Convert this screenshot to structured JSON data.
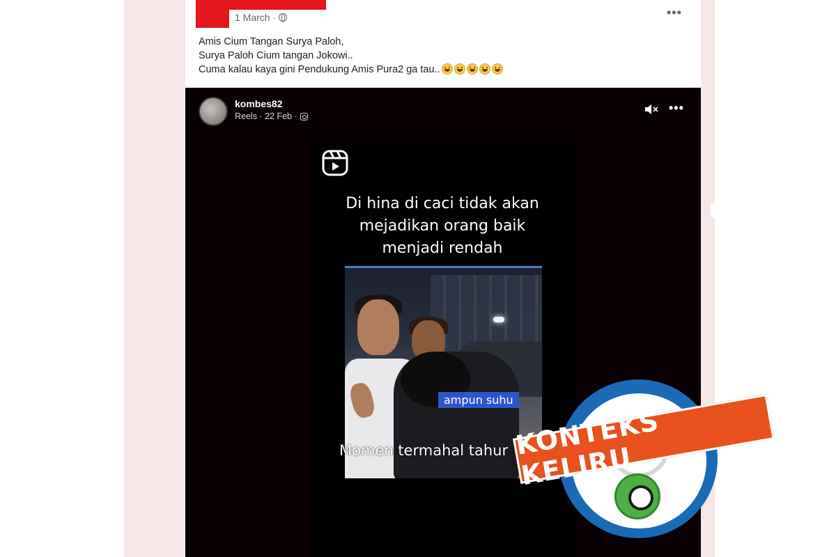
{
  "post": {
    "date": "1 March",
    "text_lines": [
      "Amis Cium Tangan Surya Paloh,",
      "Surya Paloh Cium tangan Jokowi..",
      "Cuma kalau kaya gini Pendukung Amis Pura2 ga tau.."
    ],
    "emoji_count": 5,
    "emoji_name": "grinning-face",
    "globe_icon": "globe-icon",
    "more_icon": "more-options-icon"
  },
  "reel": {
    "author": "kombes82",
    "meta": "Reels · 22 Feb ·",
    "caption_lines": [
      "Di hina di caci tidak akan",
      "mejadikan orang baik",
      "menjadi rendah"
    ],
    "chip_label": "ampun suhu",
    "subtitle": "Momen termahal tahur",
    "icons": [
      "instagram-icon",
      "mute-icon",
      "more-options-icon",
      "reels-icon"
    ]
  },
  "stamp": {
    "label": "KONTEKS KELIRU",
    "logo": "Kompas.com cek fakta seal"
  },
  "colors": {
    "feed_bg": "#f5e7e7",
    "redaction": "#e5161d",
    "reel_bg": "#080004",
    "chip": "#2f55c9",
    "stamp_banner": "#e8511e",
    "stamp_ring": "#1b6ab7",
    "seal_green": "#4fae45"
  }
}
